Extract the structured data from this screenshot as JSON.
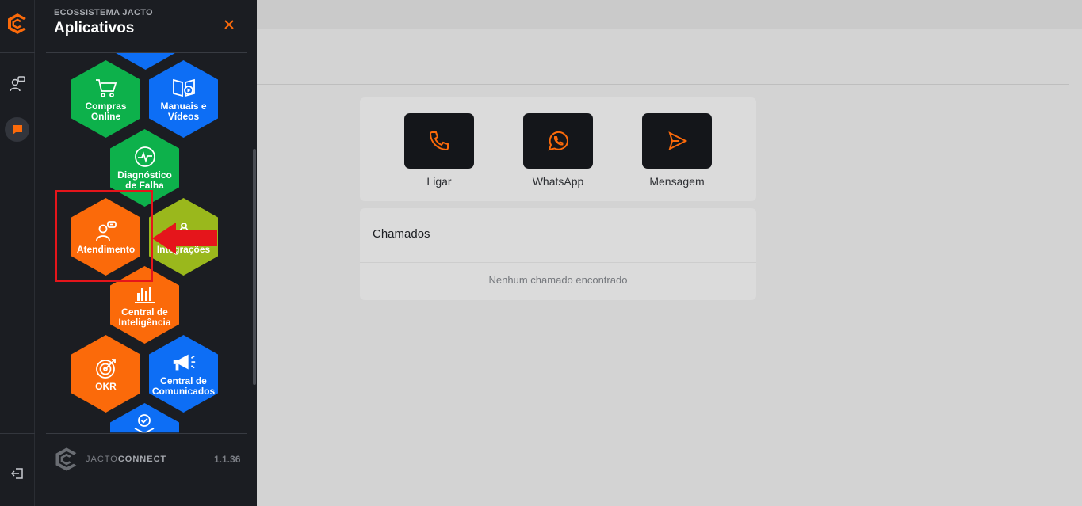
{
  "drawer": {
    "subtitle": "ECOSSISTEMA JACTO",
    "title": "Aplicativos",
    "footer_brand_light": "JACTO",
    "footer_brand_bold": "CONNECT",
    "version": "1.1.36"
  },
  "apps": [
    {
      "label": "Compras\nOnline",
      "icon": "shopping-cart-icon",
      "color": "#0db14b"
    },
    {
      "label": "Manuais e\nVídeos",
      "icon": "manual-video-icon",
      "color": "#0d6ef5"
    },
    {
      "label": "Diagnóstico\nde Falha",
      "icon": "diagnostic-icon",
      "color": "#0db14b"
    },
    {
      "label": "Atendimento",
      "icon": "support-person-icon",
      "color": "#fb6a0a"
    },
    {
      "label": "Integrações",
      "icon": "integration-icon",
      "color": "#9ab81c"
    },
    {
      "label": "Central de\nInteligência",
      "icon": "bar-chart-icon",
      "color": "#fb6a0a"
    },
    {
      "label": "OKR",
      "icon": "target-icon",
      "color": "#fb6a0a"
    },
    {
      "label": "Central de\nComunicados",
      "icon": "megaphone-icon",
      "color": "#0d6ef5"
    }
  ],
  "contact": {
    "actions": [
      {
        "label": "Ligar",
        "icon": "phone-icon"
      },
      {
        "label": "WhatsApp",
        "icon": "whatsapp-icon"
      },
      {
        "label": "Mensagem",
        "icon": "send-icon"
      }
    ]
  },
  "tickets": {
    "title": "Chamados",
    "empty": "Nenhum chamado encontrado"
  },
  "colors": {
    "accent": "#fb6a0a",
    "sidebar_bg": "#1b1d22",
    "highlight": "#e5151b"
  }
}
